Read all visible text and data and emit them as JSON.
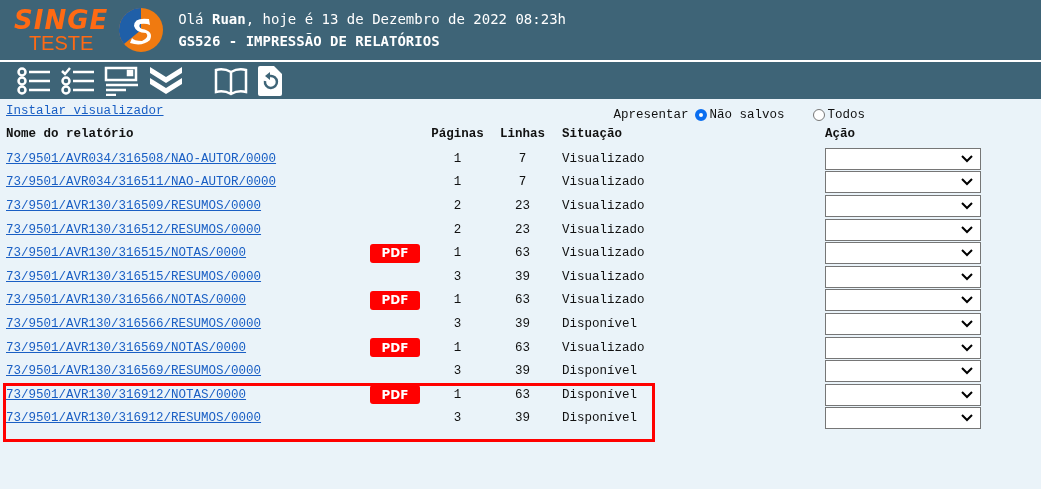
{
  "header": {
    "logo_top": "SINGE",
    "logo_bottom": "TESTE",
    "greeting": "Olá **Ruan**, hoje é 13 de Dezembro de 2022 08:23h",
    "title": "GS526 - IMPRESSÃO DE RELATÓRIOS"
  },
  "toolbar": [
    {
      "kind": "list"
    },
    {
      "kind": "checklist"
    },
    {
      "kind": "form"
    },
    {
      "kind": "chevrons"
    },
    {
      "kind": "book"
    },
    {
      "kind": "refresh"
    }
  ],
  "install_link": "Instalar visualizador",
  "filter": {
    "label": "Apresentar",
    "options": [
      {
        "label": "Não salvos",
        "selected": true
      },
      {
        "label": "Todos",
        "selected": false
      }
    ]
  },
  "table": {
    "columns": [
      "Nome do relatório",
      "Páginas",
      "Linhas",
      "Situação",
      "Ação"
    ],
    "rows": [
      {
        "name": "73/9501/AVR034/316508/NAO-AUTOR/0000",
        "pdf": false,
        "pages": "1",
        "lines": "7",
        "status": "Visualizado",
        "highlighted": false
      },
      {
        "name": "73/9501/AVR034/316511/NAO-AUTOR/0000",
        "pdf": false,
        "pages": "1",
        "lines": "7",
        "status": "Visualizado",
        "highlighted": false
      },
      {
        "name": "73/9501/AVR130/316509/RESUMOS/0000",
        "pdf": false,
        "pages": "2",
        "lines": "23",
        "status": "Visualizado",
        "highlighted": false
      },
      {
        "name": "73/9501/AVR130/316512/RESUMOS/0000",
        "pdf": false,
        "pages": "2",
        "lines": "23",
        "status": "Visualizado",
        "highlighted": false
      },
      {
        "name": "73/9501/AVR130/316515/NOTAS/0000",
        "pdf": "PDF",
        "pages": "1",
        "lines": "63",
        "status": "Visualizado",
        "highlighted": false
      },
      {
        "name": "73/9501/AVR130/316515/RESUMOS/0000",
        "pdf": false,
        "pages": "3",
        "lines": "39",
        "status": "Visualizado",
        "highlighted": false
      },
      {
        "name": "73/9501/AVR130/316566/NOTAS/0000",
        "pdf": "PDF",
        "pages": "1",
        "lines": "63",
        "status": "Visualizado",
        "highlighted": false
      },
      {
        "name": "73/9501/AVR130/316566/RESUMOS/0000",
        "pdf": false,
        "pages": "3",
        "lines": "39",
        "status": "Disponível",
        "highlighted": false
      },
      {
        "name": "73/9501/AVR130/316569/NOTAS/0000",
        "pdf": "PDF",
        "pages": "1",
        "lines": "63",
        "status": "Visualizado",
        "highlighted": false
      },
      {
        "name": "73/9501/AVR130/316569/RESUMOS/0000",
        "pdf": false,
        "pages": "3",
        "lines": "39",
        "status": "Disponível",
        "highlighted": false
      },
      {
        "name": "73/9501/AVR130/316912/NOTAS/0000",
        "pdf": "PDF",
        "pages": "1",
        "lines": "63",
        "status": "Disponível",
        "highlighted": true
      },
      {
        "name": "73/9501/AVR130/316912/RESUMOS/0000",
        "pdf": false,
        "pages": "3",
        "lines": "39",
        "status": "Disponível",
        "highlighted": true
      }
    ]
  }
}
